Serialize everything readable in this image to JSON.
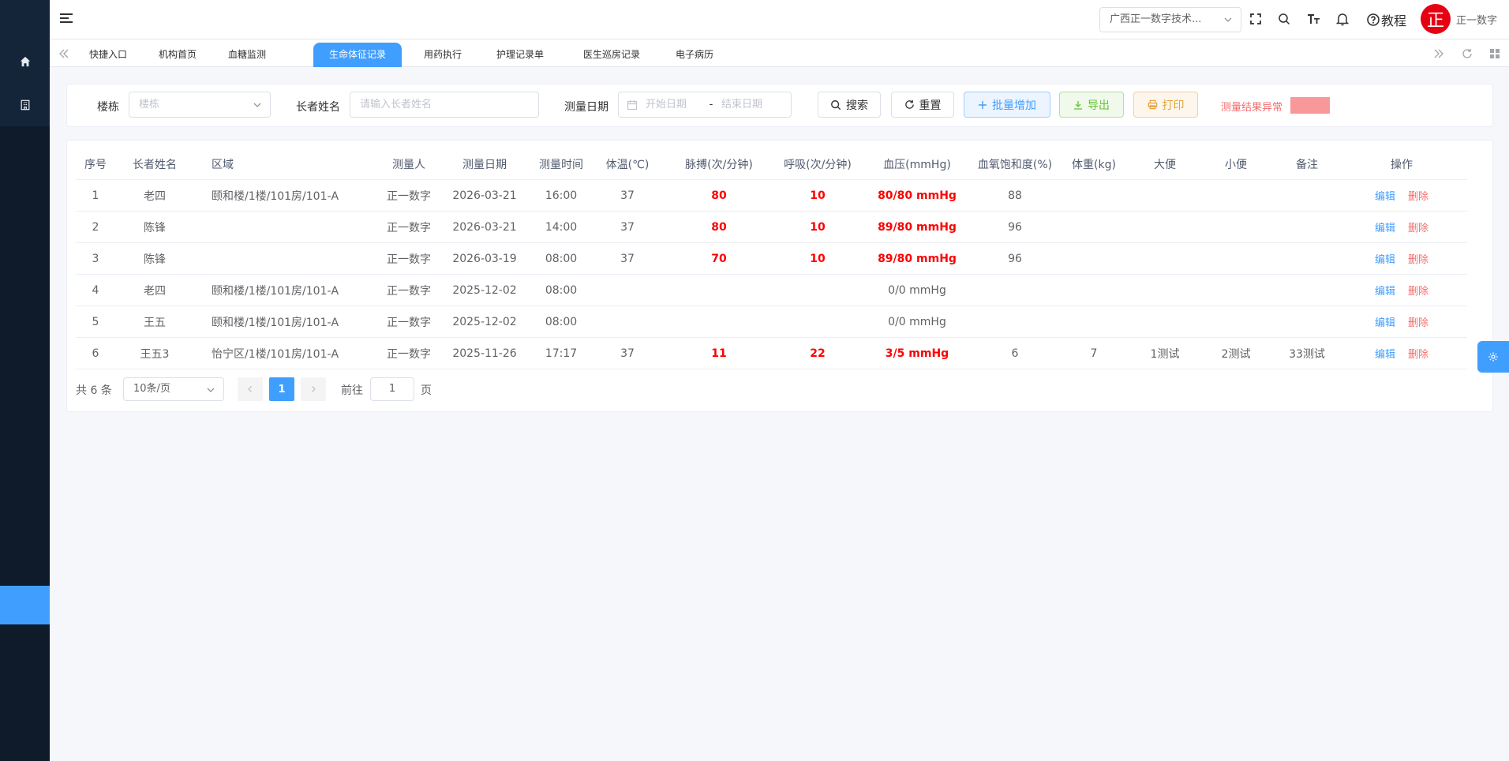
{
  "sidebar": {
    "items": [
      {
        "icon": "home-icon"
      },
      {
        "icon": "building-icon"
      }
    ]
  },
  "header": {
    "org_selector": "广西正一数字技术...",
    "tutorial_label": "教程",
    "avatar_text": "正",
    "username": "正一数字"
  },
  "tabs": [
    {
      "label": "快捷入口"
    },
    {
      "label": "机构首页"
    },
    {
      "label": "血糖监测"
    },
    {
      "label": "生命体征记录",
      "active": true
    },
    {
      "label": "用药执行"
    },
    {
      "label": "护理记录单"
    },
    {
      "label": "医生巡房记录"
    },
    {
      "label": "电子病历"
    }
  ],
  "filters": {
    "building_label": "楼栋",
    "building_placeholder": "楼栋",
    "name_label": "长者姓名",
    "name_placeholder": "请输入长者姓名",
    "date_label": "测量日期",
    "start_placeholder": "开始日期",
    "date_sep": "-",
    "end_placeholder": "结束日期",
    "search_btn": "搜索",
    "reset_btn": "重置",
    "batch_add_btn": "批量增加",
    "export_btn": "导出",
    "print_btn": "打印",
    "abnormal_legend": "测量结果异常",
    "abnormal_color": "#f89898"
  },
  "table": {
    "headers": [
      "序号",
      "长者姓名",
      "区域",
      "测量人",
      "测量日期",
      "测量时间",
      "体温(℃)",
      "脉搏(次/分钟)",
      "呼吸(次/分钟)",
      "血压(mmHg)",
      "血氧饱和度(%)",
      "体重(kg)",
      "大便",
      "小便",
      "备注",
      "操作"
    ],
    "edit_label": "编辑",
    "delete_label": "删除",
    "rows": [
      {
        "no": "1",
        "name": "老四",
        "area": "颐和楼/1楼/101房/101-A",
        "measurer": "正一数字",
        "date": "2026-03-21",
        "time": "16:00",
        "temp": "37",
        "pulse": "80",
        "resp": "10",
        "bp": "80/80 mmHg",
        "spo2": "88",
        "weight": "",
        "stool": "",
        "urine": "",
        "remark": "",
        "warn": true
      },
      {
        "no": "2",
        "name": "陈锋",
        "area": "",
        "measurer": "正一数字",
        "date": "2026-03-21",
        "time": "14:00",
        "temp": "37",
        "pulse": "80",
        "resp": "10",
        "bp": "89/80 mmHg",
        "spo2": "96",
        "weight": "",
        "stool": "",
        "urine": "",
        "remark": "",
        "warn": true
      },
      {
        "no": "3",
        "name": "陈锋",
        "area": "",
        "measurer": "正一数字",
        "date": "2026-03-19",
        "time": "08:00",
        "temp": "37",
        "pulse": "70",
        "resp": "10",
        "bp": "89/80 mmHg",
        "spo2": "96",
        "weight": "",
        "stool": "",
        "urine": "",
        "remark": "",
        "warn": true
      },
      {
        "no": "4",
        "name": "老四",
        "area": "颐和楼/1楼/101房/101-A",
        "measurer": "正一数字",
        "date": "2025-12-02",
        "time": "08:00",
        "temp": "",
        "pulse": "",
        "resp": "",
        "bp": "0/0 mmHg",
        "spo2": "",
        "weight": "",
        "stool": "",
        "urine": "",
        "remark": "",
        "warn": false
      },
      {
        "no": "5",
        "name": "王五",
        "area": "颐和楼/1楼/101房/101-A",
        "measurer": "正一数字",
        "date": "2025-12-02",
        "time": "08:00",
        "temp": "",
        "pulse": "",
        "resp": "",
        "bp": "0/0 mmHg",
        "spo2": "",
        "weight": "",
        "stool": "",
        "urine": "",
        "remark": "",
        "warn": false
      },
      {
        "no": "6",
        "name": "王五3",
        "area": "怡宁区/1楼/101房/101-A",
        "measurer": "正一数字",
        "date": "2025-11-26",
        "time": "17:17",
        "temp": "37",
        "pulse": "11",
        "resp": "22",
        "bp": "3/5 mmHg",
        "spo2": "6",
        "weight": "7",
        "stool": "1测试",
        "urine": "2测试",
        "remark": "33测试",
        "warn": true
      }
    ]
  },
  "pagination": {
    "total": "共 6 条",
    "page_size": "10条/页",
    "current_page": "1",
    "goto_label": "前往",
    "goto_value": "1",
    "page_suffix": "页"
  }
}
